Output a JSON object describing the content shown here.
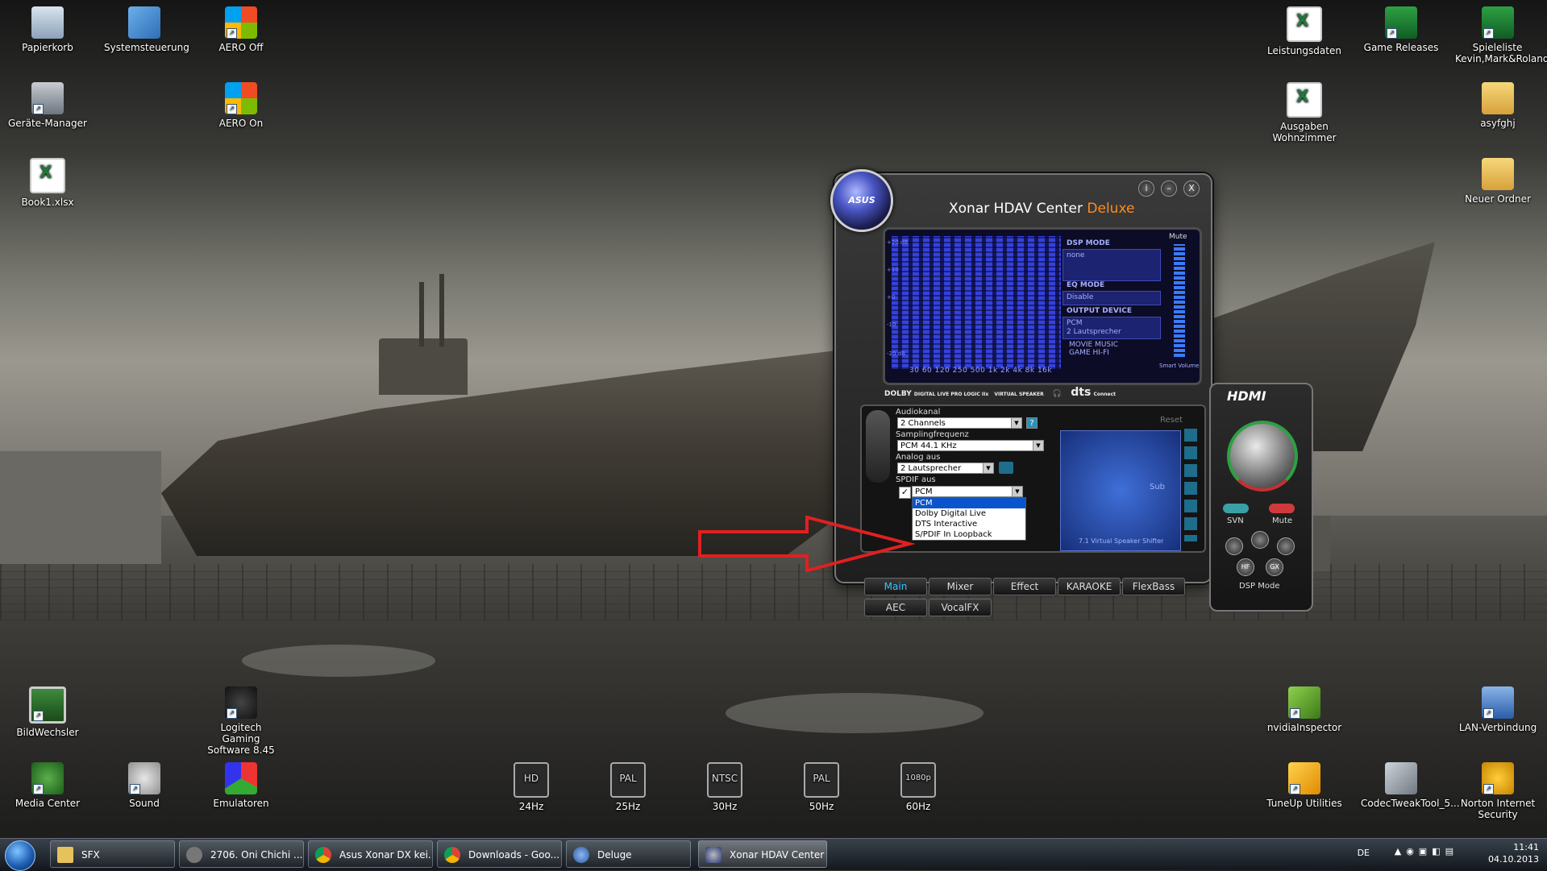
{
  "desktop": {
    "icons_left": [
      {
        "label": "Papierkorb",
        "icon": "recycle-bin-icon"
      },
      {
        "label": "Systemsteuerung",
        "icon": "control-panel-icon"
      },
      {
        "label": "AERO Off",
        "icon": "windows-logo-icon"
      },
      {
        "label": "Geräte-Manager",
        "icon": "device-manager-icon"
      },
      {
        "label": "AERO On",
        "icon": "windows-logo-icon"
      },
      {
        "label": "Book1.xlsx",
        "icon": "excel-file-icon"
      }
    ],
    "icons_right": [
      {
        "label": "Leistungsdaten",
        "icon": "spreadsheet-icon"
      },
      {
        "label": "Game Releases",
        "icon": "spreadsheet-green-icon"
      },
      {
        "label": "Spieleliste Kevin,Mark&Roland",
        "icon": "spreadsheet-green-icon"
      },
      {
        "label": "Ausgaben Wohnzimmer",
        "icon": "spreadsheet-icon"
      },
      {
        "label": "asyfghj",
        "icon": "folder-icon"
      },
      {
        "label": "Neuer Ordner",
        "icon": "folder-icon"
      }
    ],
    "icons_bottom": [
      {
        "label": "BildWechsler",
        "icon": "monitor-icon"
      },
      {
        "label": "Logitech Gaming Software 8.45",
        "icon": "logitech-icon"
      },
      {
        "label": "Media Center",
        "icon": "media-center-icon"
      },
      {
        "label": "Sound",
        "icon": "speaker-icon"
      },
      {
        "label": "Emulatoren",
        "icon": "emulator-icon"
      },
      {
        "label": "24Hz",
        "badge": "HD",
        "icon": "video-mode-icon"
      },
      {
        "label": "25Hz",
        "badge": "PAL",
        "icon": "video-mode-icon"
      },
      {
        "label": "30Hz",
        "badge": "NTSC",
        "icon": "video-mode-icon"
      },
      {
        "label": "50Hz",
        "badge": "PAL",
        "icon": "video-mode-icon"
      },
      {
        "label": "60Hz",
        "badge": "1080p",
        "icon": "video-mode-icon"
      },
      {
        "label": "nvidiaInspector",
        "icon": "nvidia-icon"
      },
      {
        "label": "LAN-Verbindung",
        "icon": "network-icon"
      },
      {
        "label": "TuneUp Utilities",
        "icon": "tuneup-icon"
      },
      {
        "label": "CodecTweakTool_5...",
        "icon": "tools-icon"
      },
      {
        "label": "Norton Internet Security",
        "icon": "norton-icon"
      }
    ]
  },
  "xonar": {
    "brand": "ASUS",
    "title_main": "Xonar HDAV Center",
    "title_accent": "Deluxe",
    "buttons": {
      "info": "i",
      "minimize": "–",
      "close": "X"
    },
    "lcd": {
      "scale": [
        "+20 dB",
        "+10",
        "+0",
        "-10",
        "-20 dB"
      ],
      "freqs": "30  60  120  250 500  1k   2k   4k   8k  16k",
      "dsp_mode_label": "DSP MODE",
      "dsp_mode_value": "none",
      "eq_mode_label": "EQ MODE",
      "eq_mode_value": "Disable",
      "output_label": "OUTPUT DEVICE",
      "output_value1": "PCM",
      "output_value2": "2 Lautsprecher",
      "modes": "MOVIE   MUSIC",
      "modes2": "GAME    HI-FI",
      "mute_label": "Mute",
      "smart_volume": "Smart Volume"
    },
    "logos": {
      "dolby": "DOLBY",
      "dolby_sub": "DIGITAL LIVE PRO LOGIC IIx",
      "virtual": "VIRTUAL SPEAKER",
      "dts": "dts",
      "dts_sub": "Connect"
    },
    "panel": {
      "audiokanal_label": "Audiokanal",
      "audiokanal_value": "2 Channels",
      "sampling_label": "Samplingfrequenz",
      "sampling_value": "PCM 44.1 KHz",
      "analog_label": "Analog aus",
      "analog_value": "2 Lautsprecher",
      "spdif_label": "SPDIF aus",
      "spdif_value": "PCM",
      "dropdown_options": [
        "PCM",
        "Dolby Digital Live",
        "DTS Interactive",
        "S/PDIF In Loopback"
      ],
      "reset_label": "Reset",
      "help": "?",
      "shifter_label": "7.1 Virtual Speaker Shifter",
      "sub_label": "Sub"
    },
    "tabs": [
      "Main",
      "Mixer",
      "Effect",
      "KARAOKE",
      "FlexBass",
      "AEC",
      "VocalFX"
    ],
    "hdmi": {
      "title": "HDMI",
      "svn": "SVN",
      "mute": "Mute",
      "hf": "HF",
      "gx": "GX",
      "dsp_mode": "DSP Mode"
    }
  },
  "taskbar": {
    "items": [
      {
        "label": "SFX",
        "icon": "folder-icon"
      },
      {
        "label": "2706. Oni Chichi ...",
        "icon": "torrent-icon"
      },
      {
        "label": "Asus Xonar DX kei...",
        "icon": "chrome-icon"
      },
      {
        "label": "Downloads - Goo...",
        "icon": "chrome-icon"
      },
      {
        "label": "Deluge",
        "icon": "deluge-icon"
      },
      {
        "label": "Xonar HDAV Center",
        "icon": "xonar-icon"
      }
    ],
    "tray": {
      "lang": "DE",
      "time": "11:41",
      "date": "04.10.2013"
    }
  },
  "colors": {
    "accent_orange": "#ff8b1f",
    "tab_active": "#36c6ff",
    "highlight": "#0a55cc",
    "arrow_red": "#e02020"
  }
}
